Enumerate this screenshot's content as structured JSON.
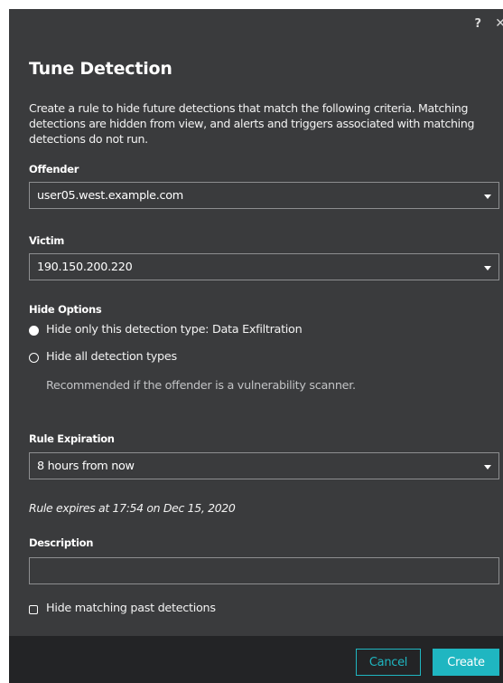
{
  "dialog": {
    "title": "Tune Detection",
    "intro": "Create a rule to hide future detections that match the following criteria. Matching detections are hidden from view, and alerts and triggers associated with matching detections do not run.",
    "icons": {
      "help": "?",
      "close": "✕"
    }
  },
  "offender": {
    "label": "Offender",
    "value": "user05.west.example.com"
  },
  "victim": {
    "label": "Victim",
    "value": "190.150.200.220"
  },
  "hide_options": {
    "label": "Hide Options",
    "options": [
      {
        "label": "Hide only this detection type: Data Exfiltration",
        "selected": true
      },
      {
        "label": "Hide all detection types",
        "selected": false
      }
    ],
    "hint": "Recommended if the offender is a vulnerability scanner."
  },
  "rule_expiration": {
    "label": "Rule Expiration",
    "value": "8 hours from now",
    "note": "Rule expires at 17:54 on Dec 15, 2020"
  },
  "description": {
    "label": "Description",
    "value": "",
    "placeholder": ""
  },
  "hide_past": {
    "label": "Hide matching past detections",
    "checked": false
  },
  "footer": {
    "cancel_label": "Cancel",
    "create_label": "Create"
  },
  "colors": {
    "dialog_bg": "#3a3b3d",
    "footer_bg": "#232426",
    "accent": "#1fb6c1"
  }
}
